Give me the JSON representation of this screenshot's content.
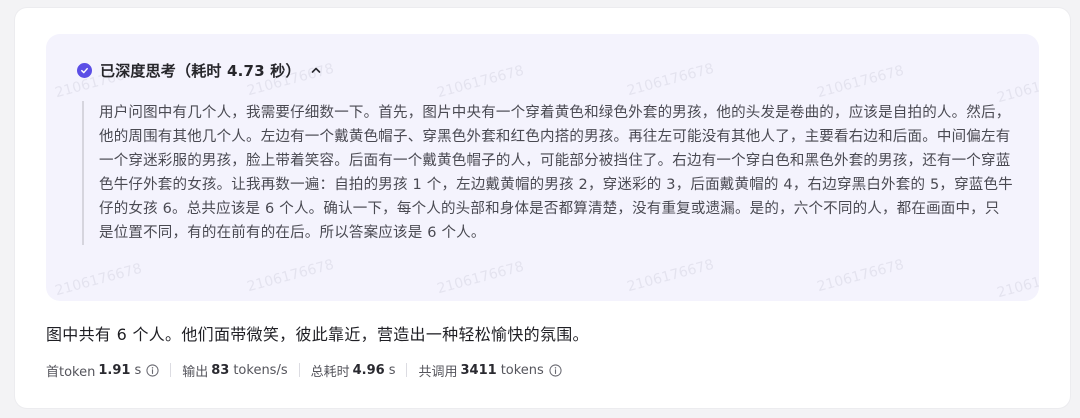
{
  "thinking": {
    "title": "已深度思考（耗时 4.73 秒）",
    "content": "用户问图中有几个人，我需要仔细数一下。首先，图片中央有一个穿着黄色和绿色外套的男孩，他的头发是卷曲的，应该是自拍的人。然后，他的周围有其他几个人。左边有一个戴黄色帽子、穿黑色外套和红色内搭的男孩。再往左可能没有其他人了，主要看右边和后面。中间偏左有一个穿迷彩服的男孩，脸上带着笑容。后面有一个戴黄色帽子的人，可能部分被挡住了。右边有一个穿白色和黑色外套的男孩，还有一个穿蓝色牛仔外套的女孩。让我再数一遍：自拍的男孩 1 个，左边戴黄帽的男孩 2，穿迷彩的 3，后面戴黄帽的 4，右边穿黑白外套的 5，穿蓝色牛仔的女孩 6。总共应该是 6 个人。确认一下，每个人的头部和身体是否都算清楚，没有重复或遗漏。是的，六个不同的人，都在画面中，只是位置不同，有的在前有的在后。所以答案应该是 6 个人。",
    "check_icon": "check-circle-icon",
    "toggle_icon": "chevron-up-icon"
  },
  "answer": "图中共有 6 个人。他们面带微笑，彼此靠近，营造出一种轻松愉快的氛围。",
  "stats": {
    "first_token_label": "首token",
    "first_token_value": "1.91",
    "first_token_unit": "s",
    "output_label": "输出",
    "output_value": "83",
    "output_unit": "tokens/s",
    "total_time_label": "总耗时",
    "total_time_value": "4.96",
    "total_time_unit": "s",
    "calls_label": "共调用",
    "calls_value": "3411",
    "calls_unit": "tokens",
    "info_icon": "info-icon"
  },
  "watermark": "2106176678",
  "colors": {
    "accent": "#5b4ee6",
    "think_bg": "#f4f3fd"
  }
}
